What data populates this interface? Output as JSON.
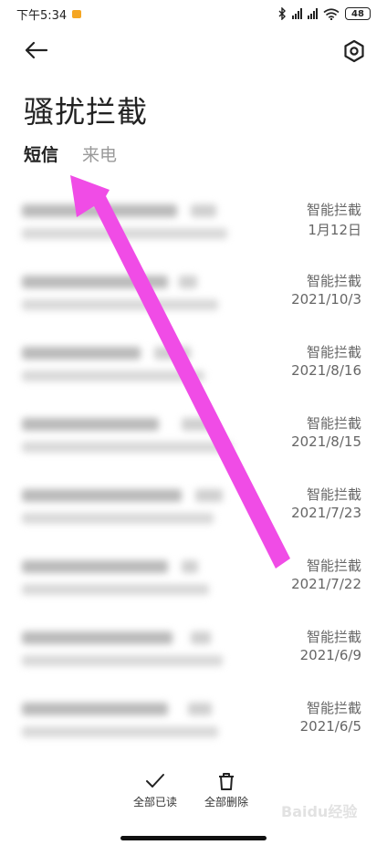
{
  "status_bar": {
    "time": "下午5:34",
    "battery": "48"
  },
  "header": {
    "title": "骚扰拦截"
  },
  "tabs": [
    {
      "label": "短信",
      "active": true
    },
    {
      "label": "来电",
      "active": false
    }
  ],
  "messages": [
    {
      "tag": "智能拦截",
      "date": "1月12日"
    },
    {
      "tag": "智能拦截",
      "date": "2021/10/3"
    },
    {
      "tag": "智能拦截",
      "date": "2021/8/16"
    },
    {
      "tag": "智能拦截",
      "date": "2021/8/15"
    },
    {
      "tag": "智能拦截",
      "date": "2021/7/23"
    },
    {
      "tag": "智能拦截",
      "date": "2021/7/22"
    },
    {
      "tag": "智能拦截",
      "date": "2021/6/9"
    },
    {
      "tag": "智能拦截",
      "date": "2021/6/5"
    }
  ],
  "bottom_bar": {
    "read_all_label": "全部已读",
    "delete_all_label": "全部删除"
  },
  "watermark": "Baidu经验",
  "colors": {
    "annotation_arrow": "#f04ce6",
    "notification": "#f5a623"
  }
}
